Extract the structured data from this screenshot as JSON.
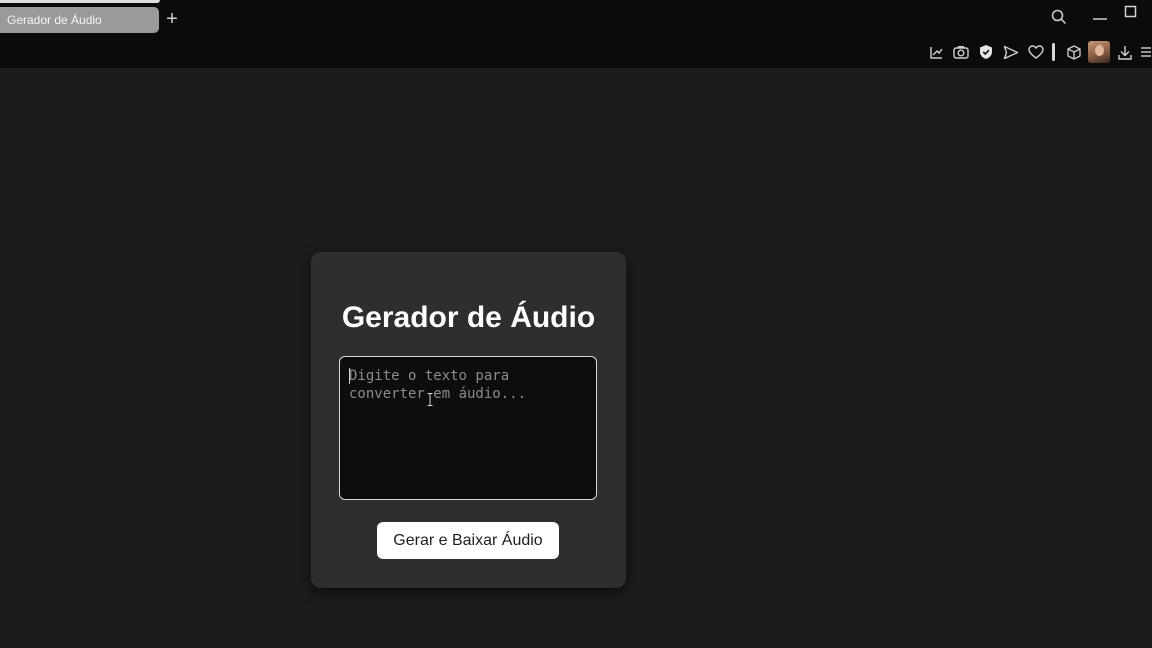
{
  "browser": {
    "tab_title": "Gerador de Áudio",
    "new_tab_symbol": "+",
    "icons": {
      "search": "search-icon",
      "minimize": "minimize-icon",
      "maximize": "maximize-icon",
      "toolbar": [
        "edit-chart-icon",
        "camera-icon",
        "shield-icon",
        "send-icon",
        "heart-icon",
        "cube-icon",
        "avatar",
        "download-icon",
        "menu-icon"
      ]
    }
  },
  "card": {
    "title": "Gerador de Áudio",
    "textarea_placeholder": "Digite o texto para converter em áudio...",
    "textarea_value": "",
    "button_label": "Gerar e Baixar Áudio"
  },
  "colors": {
    "page_background": "#1c1c1c",
    "card_background": "#2e2e2e",
    "textarea_background": "#0d0d0d",
    "button_background": "#ffffff",
    "title_text": "#ffffff"
  }
}
